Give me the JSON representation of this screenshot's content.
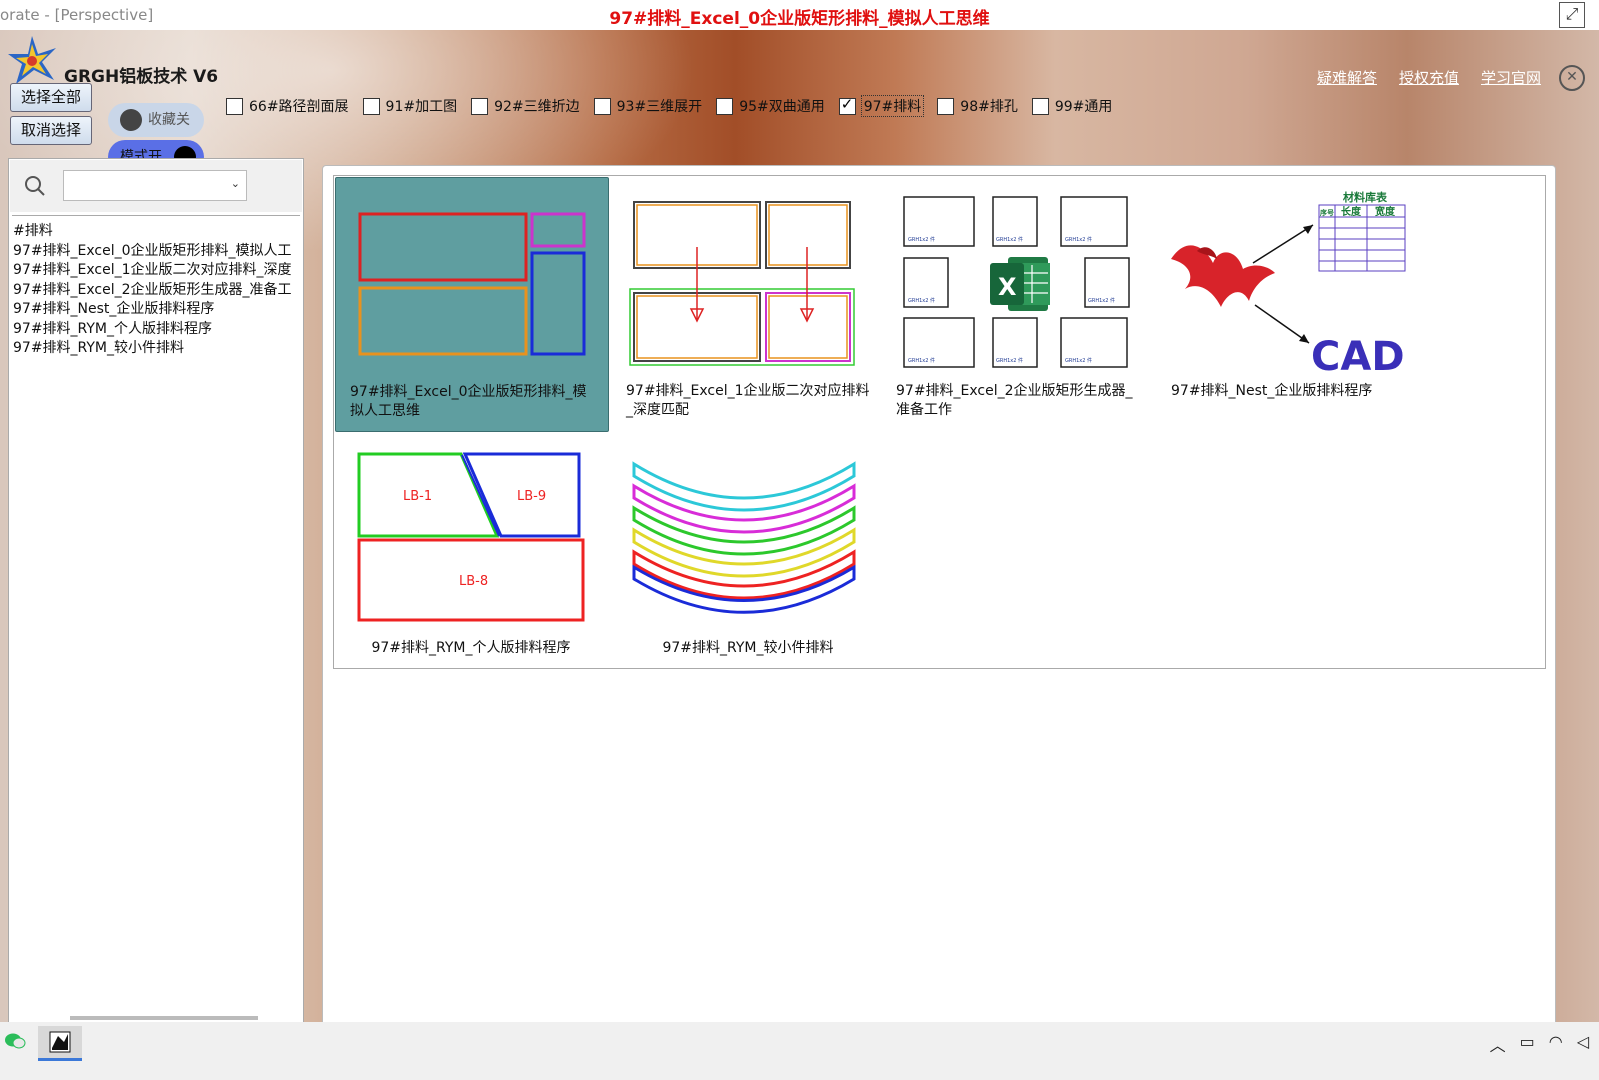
{
  "window": {
    "system_title": "orate - [Perspective]",
    "doc_title": "97#排料_Excel_0企业版矩形排料_模拟人工思维",
    "app_name": "GRGH铝板技术 V6"
  },
  "links": [
    "疑难解答",
    "授权充值",
    "学习官网"
  ],
  "buttons": {
    "select_all": "选择全部",
    "deselect": "取消选择"
  },
  "toggles": {
    "favorites": "收藏关",
    "mode": "模式开"
  },
  "filters": [
    {
      "label": "66#路径剖面展",
      "checked": false
    },
    {
      "label": "91#加工图",
      "checked": false
    },
    {
      "label": "92#三维折边",
      "checked": false
    },
    {
      "label": "93#三维展开",
      "checked": false
    },
    {
      "label": "95#双曲通用",
      "checked": false
    },
    {
      "label": "97#排料",
      "checked": true
    },
    {
      "label": "98#排孔",
      "checked": false
    },
    {
      "label": "99#通用",
      "checked": false
    }
  ],
  "list_items": [
    "#排料",
    "97#排料_Excel_0企业版矩形排料_模拟人工",
    "97#排料_Excel_1企业版二次对应排料_深度",
    "97#排料_Excel_2企业版矩形生成器_准备工",
    "97#排料_Nest_企业版排料程序",
    "97#排料_RYM_个人版排料程序",
    "97#排料_RYM_较小件排料"
  ],
  "tiles": [
    {
      "caption": "97#排料_Excel_0企业版矩形排料_模拟人工思维",
      "selected": true
    },
    {
      "caption": "97#排料_Excel_1企业版二次对应排料_深度匹配",
      "selected": false
    },
    {
      "caption": "97#排料_Excel_2企业版矩形生成器_准备工作",
      "selected": false
    },
    {
      "caption": "97#排料_Nest_企业版排料程序",
      "selected": false
    },
    {
      "caption": "97#排料_RYM_个人版排料程序",
      "selected": false
    },
    {
      "caption": "97#排料_RYM_较小件排料",
      "selected": false
    }
  ],
  "thumb_text": {
    "small_panel_label": "GRH1x2 件",
    "excel_letter": "X",
    "table_title": "材料库表",
    "table_headers": [
      "序号",
      "长度",
      "宽度"
    ],
    "cad": "CAD",
    "lb1": "LB-1",
    "lb9": "LB-9",
    "lb8": "LB-8"
  },
  "colors": {
    "selected_tile": "#5f9ea0",
    "title_red": "#e01010",
    "toggle_on": "#5a6fe6",
    "toggle_off": "#c9d6e8"
  }
}
